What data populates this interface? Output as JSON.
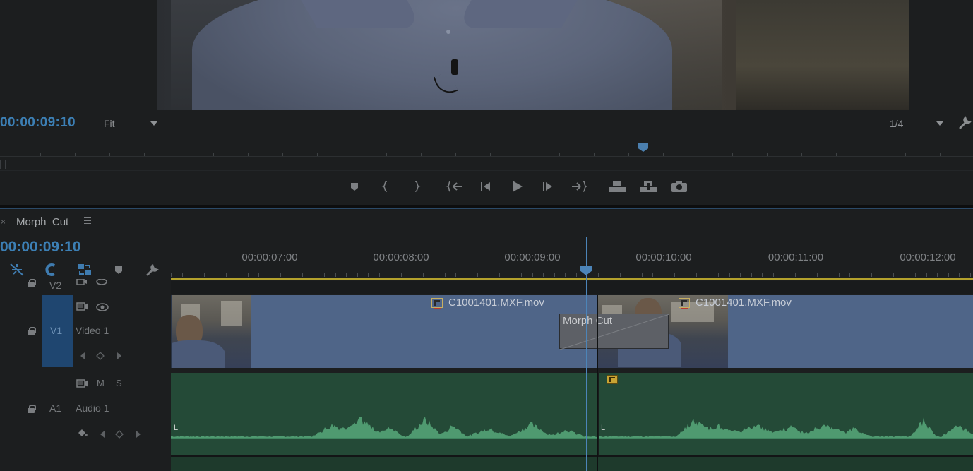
{
  "monitor": {
    "timecode": "00:00:09:10",
    "zoom_select": "Fit",
    "resolution_select": "1/4"
  },
  "timeline": {
    "sequence_name": "Morph_Cut",
    "close_glyph": "×",
    "timecode": "00:00:09:10",
    "ruler_labels": [
      "00:00:07:00",
      "00:00:08:00",
      "00:00:09:00",
      "00:00:10:00",
      "00:00:11:00",
      "00:00:12:00"
    ],
    "tracks": {
      "v2": {
        "id": "V2"
      },
      "v1": {
        "id": "V1",
        "name": "Video 1"
      },
      "a1": {
        "id": "A1",
        "name": "Audio 1",
        "mute": "M",
        "solo": "S"
      }
    },
    "clips": {
      "clip1_name": "C1001401.MXF.mov",
      "clip2_name": "C1001401.MXF.mov",
      "transition": "Morph Cut",
      "audio_marker_1": "L",
      "audio_marker_2": "L"
    }
  },
  "colors": {
    "timecode": "#3c7fb4",
    "video_clip": "#4f6588",
    "audio_clip": "#244a37",
    "waveform": "#4f9a70",
    "playhead": "#4c84b8",
    "work_area": "#b3a12c"
  }
}
